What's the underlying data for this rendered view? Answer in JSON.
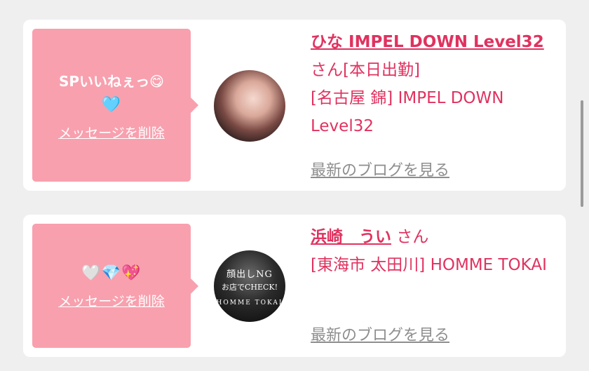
{
  "colors": {
    "background": "#efefef",
    "card": "#ffffff",
    "bubble": "#f8a0ae",
    "accent": "#e0325f",
    "muted_link": "#8e8e8e"
  },
  "messages": [
    {
      "bubble_text": "SPいいねぇっ😋",
      "bubble_emoji": "🩵",
      "delete_label": "メッセージを削除",
      "avatar_icon": "profile-photo",
      "name": "ひな IMPEL DOWN Level32",
      "honorific": "さん",
      "status": "[本日出勤]",
      "shop": "[名古屋 錦] IMPEL DOWN Level32",
      "blog_label": "最新のブログを見る"
    },
    {
      "bubble_text": "",
      "bubble_emoji": "🤍💎💖",
      "delete_label": "メッセージを削除",
      "avatar_icon": "profile-photo",
      "avatar_overlay": {
        "line1": "顔出しNG",
        "line2": "お店でCHECK!",
        "line3": "HOMME TOKAI"
      },
      "name": "浜崎　うい",
      "honorific": "さん",
      "status": "",
      "shop": "[東海市 太田川] HOMME TOKAI",
      "blog_label": "最新のブログを見る"
    }
  ]
}
